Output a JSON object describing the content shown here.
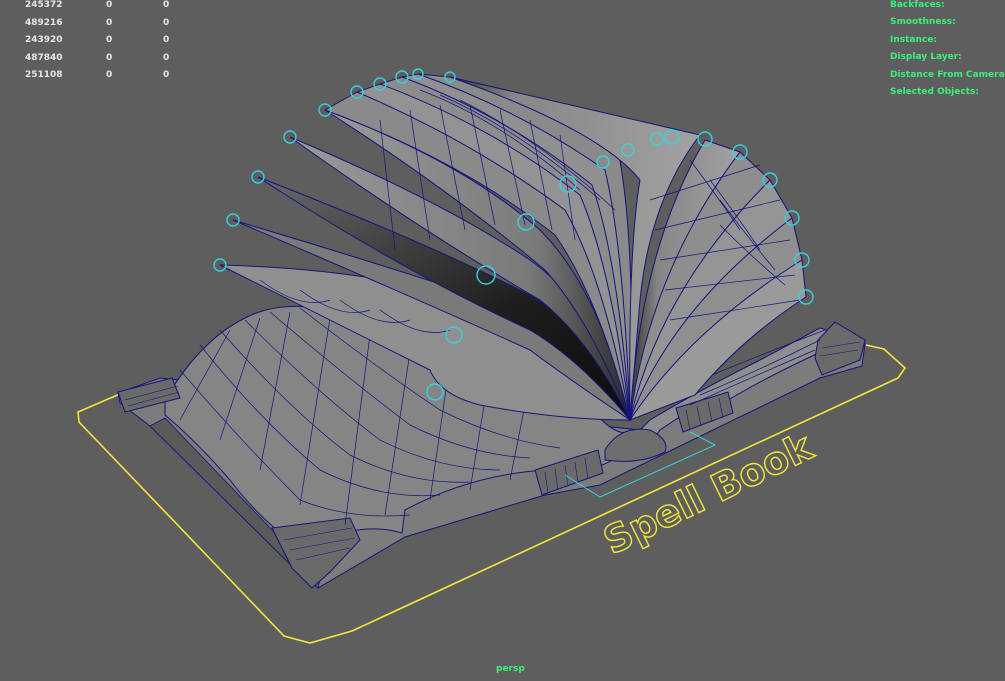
{
  "viewport": {
    "camera_name": "persp",
    "title_text": "Spell Book",
    "colors": {
      "background": "#5e5e5e",
      "mesh_fill": "#8a8a8a",
      "wireframe": "#14147a",
      "selection_outline": "#f5e63c",
      "handle": "#35d3dc",
      "hud_text": "#e6e6e6",
      "hud_label": "#3cf07a"
    }
  },
  "hud_stats": {
    "rows": [
      [
        "245372",
        "0",
        "0"
      ],
      [
        "489216",
        "0",
        "0"
      ],
      [
        "243920",
        "0",
        "0"
      ],
      [
        "487840",
        "0",
        "0"
      ],
      [
        "251108",
        "0",
        "0"
      ]
    ]
  },
  "hud_info": {
    "labels": [
      "Backfaces:",
      "Smoothness:",
      "Instance:",
      "Display Layer:",
      "Distance From Camera:",
      "Selected Objects:"
    ]
  }
}
